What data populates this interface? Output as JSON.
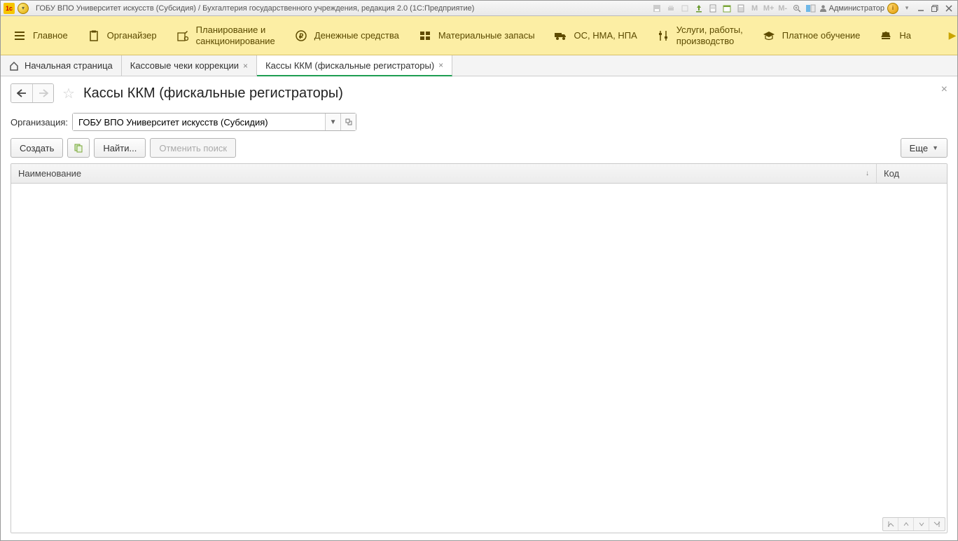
{
  "titlebar": {
    "title": "ГОБУ ВПО Университет искусств (Субсидия) / Бухгалтерия государственного учреждения, редакция 2.0  (1С:Предприятие)",
    "m_labels": [
      "M",
      "M+",
      "M-"
    ],
    "user": "Администратор"
  },
  "nav": {
    "items": [
      {
        "label": "Главное"
      },
      {
        "label": "Органайзер"
      },
      {
        "label": "Планирование и\nсанкционирование"
      },
      {
        "label": "Денежные средства"
      },
      {
        "label": "Материальные запасы"
      },
      {
        "label": "ОС, НМА, НПА"
      },
      {
        "label": "Услуги, работы,\nпроизводство"
      },
      {
        "label": "Платное обучение"
      },
      {
        "label": "На"
      }
    ]
  },
  "tabs": {
    "start": "Начальная страница",
    "items": [
      {
        "label": "Кассовые чеки коррекции"
      },
      {
        "label": "Кассы ККМ (фискальные регистраторы)"
      }
    ]
  },
  "page": {
    "title": "Кассы ККМ (фискальные регистраторы)"
  },
  "filter": {
    "label": "Организация:",
    "value": "ГОБУ ВПО Университет искусств (Субсидия)"
  },
  "toolbar": {
    "create": "Создать",
    "find": "Найти...",
    "cancel_search": "Отменить поиск",
    "more": "Еще"
  },
  "table": {
    "columns": {
      "name": "Наименование",
      "code": "Код"
    }
  }
}
